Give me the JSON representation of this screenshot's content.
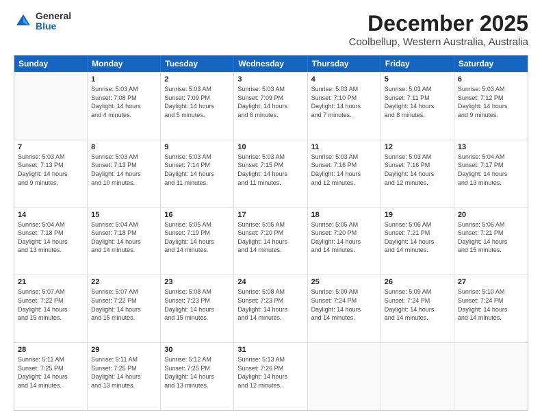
{
  "header": {
    "logo_general": "General",
    "logo_blue": "Blue",
    "main_title": "December 2025",
    "subtitle": "Coolbellup, Western Australia, Australia"
  },
  "calendar": {
    "days": [
      "Sunday",
      "Monday",
      "Tuesday",
      "Wednesday",
      "Thursday",
      "Friday",
      "Saturday"
    ],
    "weeks": [
      [
        {
          "date": "",
          "info": ""
        },
        {
          "date": "1",
          "info": "Sunrise: 5:03 AM\nSunset: 7:08 PM\nDaylight: 14 hours\nand 4 minutes."
        },
        {
          "date": "2",
          "info": "Sunrise: 5:03 AM\nSunset: 7:09 PM\nDaylight: 14 hours\nand 5 minutes."
        },
        {
          "date": "3",
          "info": "Sunrise: 5:03 AM\nSunset: 7:09 PM\nDaylight: 14 hours\nand 6 minutes."
        },
        {
          "date": "4",
          "info": "Sunrise: 5:03 AM\nSunset: 7:10 PM\nDaylight: 14 hours\nand 7 minutes."
        },
        {
          "date": "5",
          "info": "Sunrise: 5:03 AM\nSunset: 7:11 PM\nDaylight: 14 hours\nand 8 minutes."
        },
        {
          "date": "6",
          "info": "Sunrise: 5:03 AM\nSunset: 7:12 PM\nDaylight: 14 hours\nand 9 minutes."
        }
      ],
      [
        {
          "date": "7",
          "info": "Sunrise: 5:03 AM\nSunset: 7:13 PM\nDaylight: 14 hours\nand 9 minutes."
        },
        {
          "date": "8",
          "info": "Sunrise: 5:03 AM\nSunset: 7:13 PM\nDaylight: 14 hours\nand 10 minutes."
        },
        {
          "date": "9",
          "info": "Sunrise: 5:03 AM\nSunset: 7:14 PM\nDaylight: 14 hours\nand 11 minutes."
        },
        {
          "date": "10",
          "info": "Sunrise: 5:03 AM\nSunset: 7:15 PM\nDaylight: 14 hours\nand 11 minutes."
        },
        {
          "date": "11",
          "info": "Sunrise: 5:03 AM\nSunset: 7:16 PM\nDaylight: 14 hours\nand 12 minutes."
        },
        {
          "date": "12",
          "info": "Sunrise: 5:03 AM\nSunset: 7:16 PM\nDaylight: 14 hours\nand 12 minutes."
        },
        {
          "date": "13",
          "info": "Sunrise: 5:04 AM\nSunset: 7:17 PM\nDaylight: 14 hours\nand 13 minutes."
        }
      ],
      [
        {
          "date": "14",
          "info": "Sunrise: 5:04 AM\nSunset: 7:18 PM\nDaylight: 14 hours\nand 13 minutes."
        },
        {
          "date": "15",
          "info": "Sunrise: 5:04 AM\nSunset: 7:18 PM\nDaylight: 14 hours\nand 14 minutes."
        },
        {
          "date": "16",
          "info": "Sunrise: 5:05 AM\nSunset: 7:19 PM\nDaylight: 14 hours\nand 14 minutes."
        },
        {
          "date": "17",
          "info": "Sunrise: 5:05 AM\nSunset: 7:20 PM\nDaylight: 14 hours\nand 14 minutes."
        },
        {
          "date": "18",
          "info": "Sunrise: 5:05 AM\nSunset: 7:20 PM\nDaylight: 14 hours\nand 14 minutes."
        },
        {
          "date": "19",
          "info": "Sunrise: 5:06 AM\nSunset: 7:21 PM\nDaylight: 14 hours\nand 14 minutes."
        },
        {
          "date": "20",
          "info": "Sunrise: 5:06 AM\nSunset: 7:21 PM\nDaylight: 14 hours\nand 15 minutes."
        }
      ],
      [
        {
          "date": "21",
          "info": "Sunrise: 5:07 AM\nSunset: 7:22 PM\nDaylight: 14 hours\nand 15 minutes."
        },
        {
          "date": "22",
          "info": "Sunrise: 5:07 AM\nSunset: 7:22 PM\nDaylight: 14 hours\nand 15 minutes."
        },
        {
          "date": "23",
          "info": "Sunrise: 5:08 AM\nSunset: 7:23 PM\nDaylight: 14 hours\nand 15 minutes."
        },
        {
          "date": "24",
          "info": "Sunrise: 5:08 AM\nSunset: 7:23 PM\nDaylight: 14 hours\nand 14 minutes."
        },
        {
          "date": "25",
          "info": "Sunrise: 5:09 AM\nSunset: 7:24 PM\nDaylight: 14 hours\nand 14 minutes."
        },
        {
          "date": "26",
          "info": "Sunrise: 5:09 AM\nSunset: 7:24 PM\nDaylight: 14 hours\nand 14 minutes."
        },
        {
          "date": "27",
          "info": "Sunrise: 5:10 AM\nSunset: 7:24 PM\nDaylight: 14 hours\nand 14 minutes."
        }
      ],
      [
        {
          "date": "28",
          "info": "Sunrise: 5:11 AM\nSunset: 7:25 PM\nDaylight: 14 hours\nand 14 minutes."
        },
        {
          "date": "29",
          "info": "Sunrise: 5:11 AM\nSunset: 7:25 PM\nDaylight: 14 hours\nand 13 minutes."
        },
        {
          "date": "30",
          "info": "Sunrise: 5:12 AM\nSunset: 7:25 PM\nDaylight: 14 hours\nand 13 minutes."
        },
        {
          "date": "31",
          "info": "Sunrise: 5:13 AM\nSunset: 7:26 PM\nDaylight: 14 hours\nand 12 minutes."
        },
        {
          "date": "",
          "info": ""
        },
        {
          "date": "",
          "info": ""
        },
        {
          "date": "",
          "info": ""
        }
      ]
    ]
  }
}
